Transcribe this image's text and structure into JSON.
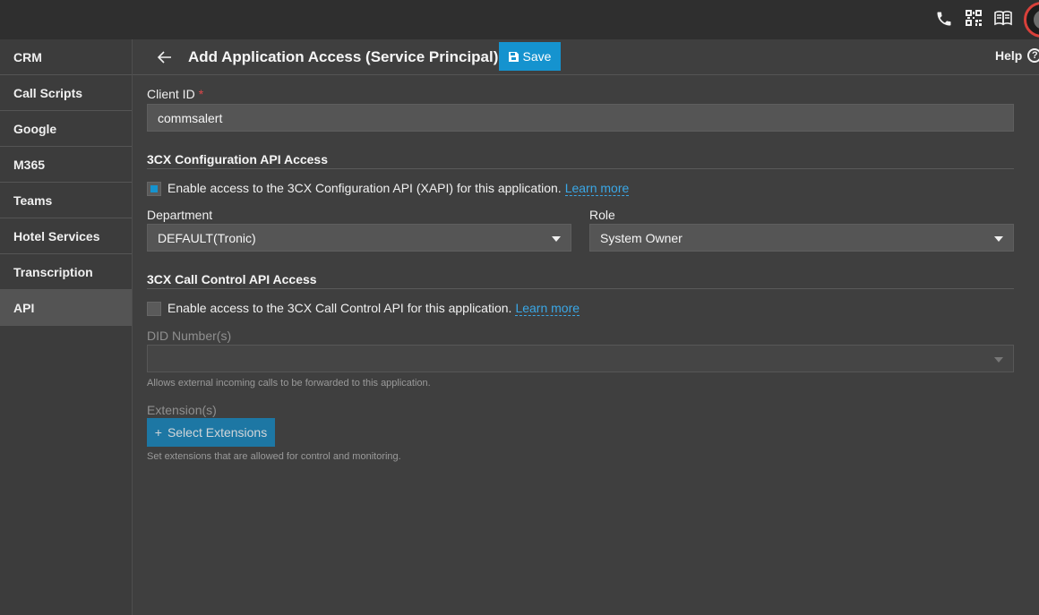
{
  "topbar": {
    "icons": [
      "phone-icon",
      "qr-code-icon",
      "book-icon"
    ]
  },
  "sidebar": {
    "items": [
      {
        "label": "CRM"
      },
      {
        "label": "Call Scripts"
      },
      {
        "label": "Google"
      },
      {
        "label": "M365"
      },
      {
        "label": "Teams"
      },
      {
        "label": "Hotel Services"
      },
      {
        "label": "Transcription"
      },
      {
        "label": "API",
        "active": true
      }
    ]
  },
  "header": {
    "title": "Add Application Access (Service Principal)",
    "save_label": "Save",
    "help_label": "Help",
    "help_glyph": "?"
  },
  "form": {
    "client_id_label": "Client ID",
    "client_id_required": "*",
    "client_id_value": "commsalert",
    "config_section_title": "3CX Configuration API Access",
    "config_checkbox_label": "Enable access to the 3CX Configuration API (XAPI) for this application.",
    "config_checked": true,
    "learn_more": "Learn more",
    "department_label": "Department",
    "department_value": "DEFAULT(Tronic)",
    "role_label": "Role",
    "role_value": "System Owner",
    "call_control_section_title": "3CX Call Control API Access",
    "call_control_checkbox_label": "Enable access to the 3CX Call Control API for this application.",
    "call_control_checked": false,
    "did_label": "DID Number(s)",
    "did_value": "",
    "did_hint": "Allows external incoming calls to be forwarded to this application.",
    "extensions_label": "Extension(s)",
    "select_extensions_label": "Select Extensions",
    "extensions_hint": "Set extensions that are allowed for control and monitoring."
  },
  "colors": {
    "accent": "#1593cf",
    "link": "#3aa7e6",
    "required": "#e0474a"
  }
}
